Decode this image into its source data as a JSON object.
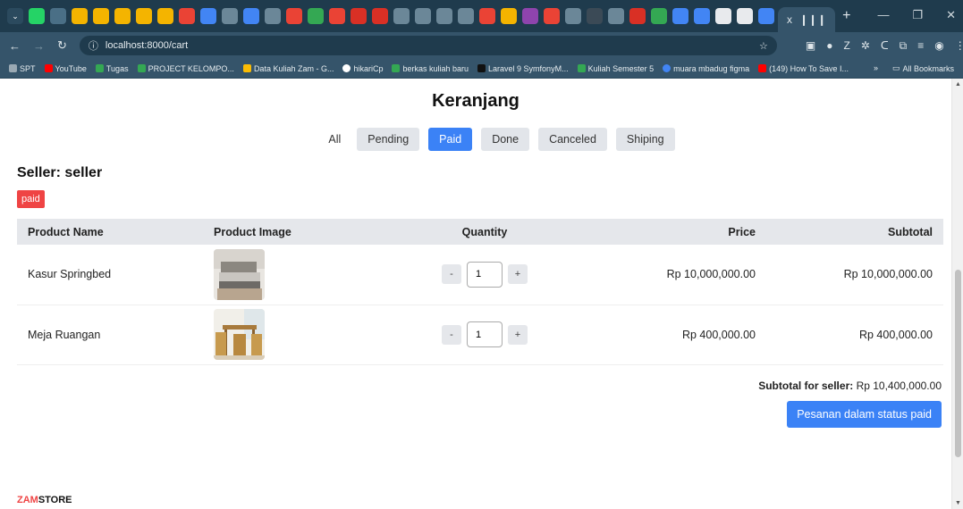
{
  "browser": {
    "url": "localhost:8000/cart",
    "tab_count_label": "x",
    "bookmarks": [
      {
        "label": "SPT",
        "color": "#9aa9b3"
      },
      {
        "label": "YouTube",
        "color": "#ff0000"
      },
      {
        "label": "Tugas",
        "color": "#34a853"
      },
      {
        "label": "PROJECT KELOMPO...",
        "color": "#34a853"
      },
      {
        "label": "Data Kuliah Zam - G...",
        "color": "#fbbc04"
      },
      {
        "label": "hikariCp",
        "color": "#ffffff"
      },
      {
        "label": "berkas kuliah baru",
        "color": "#34a853"
      },
      {
        "label": "Laravel 9 SymfonyM...",
        "color": "#111111"
      },
      {
        "label": "Kuliah Semester 5",
        "color": "#34a853"
      },
      {
        "label": "muara mbadug figma",
        "color": "#4285f4"
      },
      {
        "label": "(149) How To Save I...",
        "color": "#ff0000"
      }
    ],
    "bookmarks_overflow": "»",
    "all_bookmarks": "All Bookmarks"
  },
  "page": {
    "title": "Keranjang",
    "filters": [
      "All",
      "Pending",
      "Paid",
      "Done",
      "Canceled",
      "Shiping"
    ],
    "active_filter": "Paid",
    "seller_label": "Seller: seller",
    "status_badge": "paid",
    "table": {
      "headers": {
        "name": "Product Name",
        "image": "Product Image",
        "quantity": "Quantity",
        "price": "Price",
        "subtotal": "Subtotal"
      },
      "rows": [
        {
          "name": "Kasur Springbed",
          "qty": "1",
          "minus": "-",
          "plus": "+",
          "price": "Rp 10,000,000.00",
          "subtotal": "Rp 10,000,000.00"
        },
        {
          "name": "Meja Ruangan",
          "qty": "1",
          "minus": "-",
          "plus": "+",
          "price": "Rp 400,000.00",
          "subtotal": "Rp 400,000.00"
        }
      ]
    },
    "subtotal_label": "Subtotal for seller:",
    "subtotal_value": "Rp 10,400,000.00",
    "status_button": "Pesanan dalam status paid",
    "footer_brand_a": "ZAM",
    "footer_brand_b": "STORE"
  },
  "colors": {
    "accent": "#3b82f6",
    "badge": "#ef4444",
    "chrome_dark": "#1f3b4d",
    "chrome_mid": "#35546a"
  }
}
